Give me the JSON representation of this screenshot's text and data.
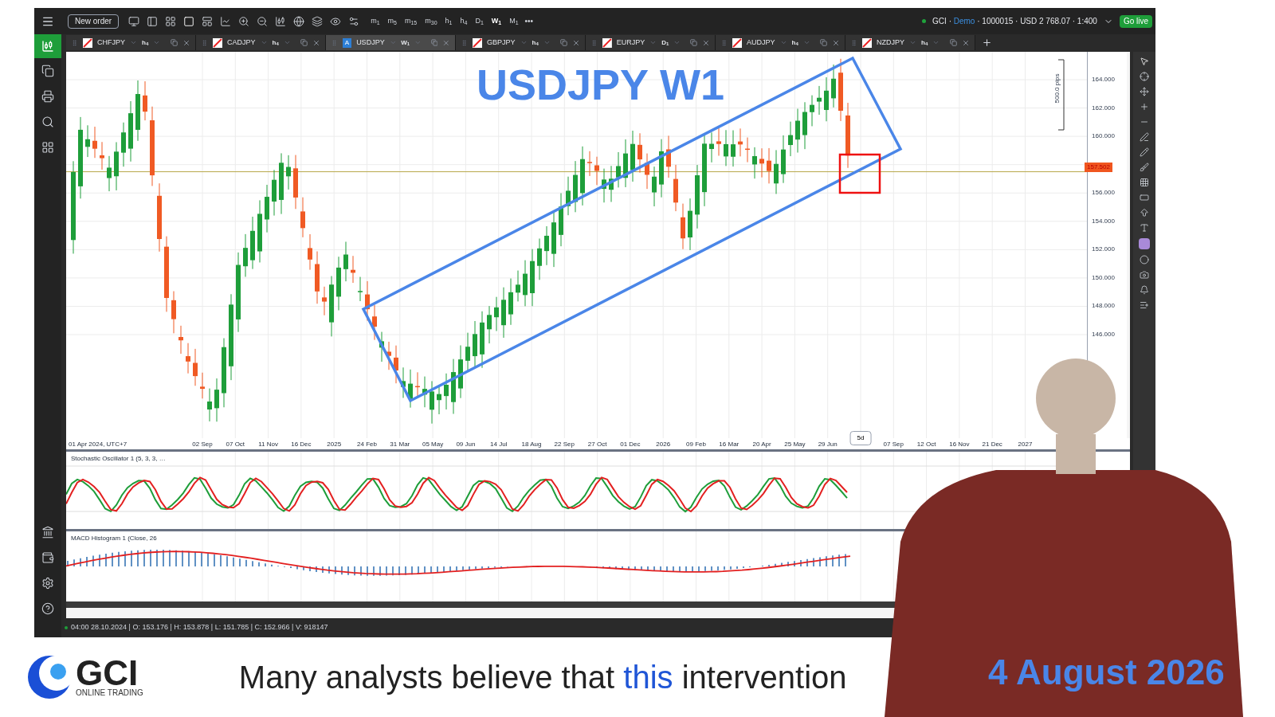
{
  "toolbar": {
    "new_order": "New order",
    "timeframes": [
      {
        "letter": "m",
        "sub": "1",
        "selected": false
      },
      {
        "letter": "m",
        "sub": "5",
        "selected": false
      },
      {
        "letter": "m",
        "sub": "15",
        "selected": false
      },
      {
        "letter": "m",
        "sub": "30",
        "selected": false
      },
      {
        "letter": "h",
        "sub": "1",
        "selected": false
      },
      {
        "letter": "h",
        "sub": "4",
        "selected": false
      },
      {
        "letter": "D",
        "sub": "1",
        "selected": false
      },
      {
        "letter": "W",
        "sub": "1",
        "selected": true
      },
      {
        "letter": "M",
        "sub": "1",
        "selected": false
      }
    ],
    "more": "•••"
  },
  "account": {
    "prefix": "GCI · ",
    "mode": "Demo",
    "details": " · 1000015 · USD 2 768.07 · 1:400",
    "go_live": "Go live"
  },
  "tabs": [
    {
      "symbol": "CHFJPY",
      "kind": "flag",
      "tf_letter": "h",
      "tf_sub": "4",
      "selected": false
    },
    {
      "symbol": "CADJPY",
      "kind": "flag",
      "tf_letter": "h",
      "tf_sub": "4",
      "selected": false
    },
    {
      "symbol": "USDJPY",
      "kind": "letter",
      "badge": "A",
      "tf_letter": "W",
      "tf_sub": "1",
      "selected": true
    },
    {
      "symbol": "GBPJPY",
      "kind": "flag",
      "tf_letter": "h",
      "tf_sub": "4",
      "selected": false
    },
    {
      "symbol": "EURJPY",
      "kind": "flag",
      "tf_letter": "D",
      "tf_sub": "1",
      "selected": false
    },
    {
      "symbol": "AUDJPY",
      "kind": "flag",
      "tf_letter": "h",
      "tf_sub": "4",
      "selected": false
    },
    {
      "symbol": "NZDJPY",
      "kind": "flag",
      "tf_letter": "h",
      "tf_sub": "4",
      "selected": false
    }
  ],
  "chart": {
    "title": "USDJPY W1",
    "pips_label": "500.0 pips",
    "y_labels": [
      {
        "text": "164.000",
        "kind": "tick"
      },
      {
        "text": "162.000",
        "kind": "tick"
      },
      {
        "text": "160.000",
        "kind": "tick"
      },
      {
        "text": "157.502",
        "kind": "current"
      },
      {
        "text": "156.000",
        "kind": "tick"
      },
      {
        "text": "154.000",
        "kind": "tick"
      },
      {
        "text": "152.000",
        "kind": "tick"
      },
      {
        "text": "150.000",
        "kind": "tick"
      },
      {
        "text": "148.000",
        "kind": "tick"
      },
      {
        "text": "146.000",
        "kind": "tick"
      }
    ],
    "x_start": "01 Apr 2024, UTC+7",
    "x_labels": [
      {
        "text": "02 Sep",
        "kind": "date"
      },
      {
        "text": "07 Oct",
        "kind": "date"
      },
      {
        "text": "11 Nov",
        "kind": "date"
      },
      {
        "text": "16 Dec",
        "kind": "date"
      },
      {
        "text": "2025",
        "kind": "date"
      },
      {
        "text": "24 Feb",
        "kind": "date"
      },
      {
        "text": "31 Mar",
        "kind": "date"
      },
      {
        "text": "05 May",
        "kind": "date"
      },
      {
        "text": "09 Jun",
        "kind": "date"
      },
      {
        "text": "14 Jul",
        "kind": "date"
      },
      {
        "text": "18 Aug",
        "kind": "date"
      },
      {
        "text": "22 Sep",
        "kind": "date"
      },
      {
        "text": "27 Oct",
        "kind": "date"
      },
      {
        "text": "01 Dec",
        "kind": "date"
      },
      {
        "text": "2026",
        "kind": "date"
      },
      {
        "text": "09 Feb",
        "kind": "date"
      },
      {
        "text": "16 Mar",
        "kind": "date"
      },
      {
        "text": "20 Apr",
        "kind": "date"
      },
      {
        "text": "25 May",
        "kind": "date"
      },
      {
        "text": "29 Jun",
        "kind": "date"
      },
      {
        "text": "5d",
        "kind": "cursor"
      },
      {
        "text": "07 Sep",
        "kind": "date"
      },
      {
        "text": "12 Oct",
        "kind": "date"
      },
      {
        "text": "16 Nov",
        "kind": "date"
      },
      {
        "text": "21 Dec",
        "kind": "date"
      },
      {
        "text": "2027",
        "kind": "date"
      }
    ]
  },
  "stochastic": {
    "label": "Stochastic Oscillator 1 (5, 3, 3, …"
  },
  "macd": {
    "label": "MACD Histogram 1 (Close, 26"
  },
  "status_bar": {
    "text": "04:00 28.10.2024 | O: 153.176 | H: 153.878 | L: 151.785 | C: 152.966 | V: 918147"
  },
  "logo": {
    "name": "GCI",
    "tagline": "ONLINE TRADING"
  },
  "caption": {
    "before": "Many analysts believe that",
    "highlight": "this",
    "after": "intervention"
  },
  "date": "4 August 2026"
}
